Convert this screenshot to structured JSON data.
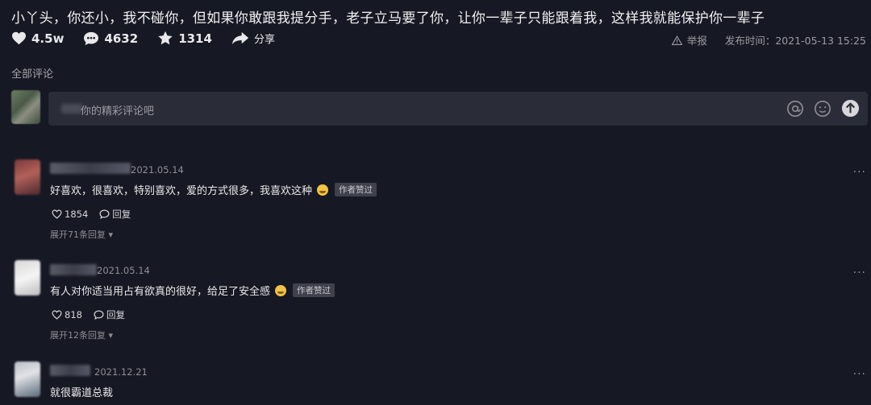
{
  "video": {
    "title": "小丫头，你还小，我不碰你，但如果你敢跟我提分手，老子立马要了你，让你一辈子只能跟着我，这样我就能保护你一辈子",
    "likes": "4.5w",
    "comments": "4632",
    "favorites": "1314",
    "share_label": "分享",
    "report_label": "举报",
    "publish_time": "发布时间：2021-05-13 15:25"
  },
  "section_label": "全部评论",
  "input": {
    "placeholder": "你的精彩评论吧"
  },
  "comments": [
    {
      "date": "2021.05.14",
      "text": "好喜欢，很喜欢，特别喜欢，爱的方式很多，我喜欢这种",
      "badge": "作者赞过",
      "likes": "1854",
      "reply_label": "回复",
      "expand": "展开71条回复"
    },
    {
      "date": "2021.05.14",
      "text": "有人对你适当用占有欲真的很好，给足了安全感",
      "badge": "作者赞过",
      "likes": "818",
      "reply_label": "回复",
      "expand": "展开12条回复"
    },
    {
      "date": "2021.12.21",
      "text": "就很霸道总裁"
    }
  ],
  "colors": {
    "background": "#161823",
    "input_bg": "#2a2c38",
    "emoji": "#f3c441"
  }
}
